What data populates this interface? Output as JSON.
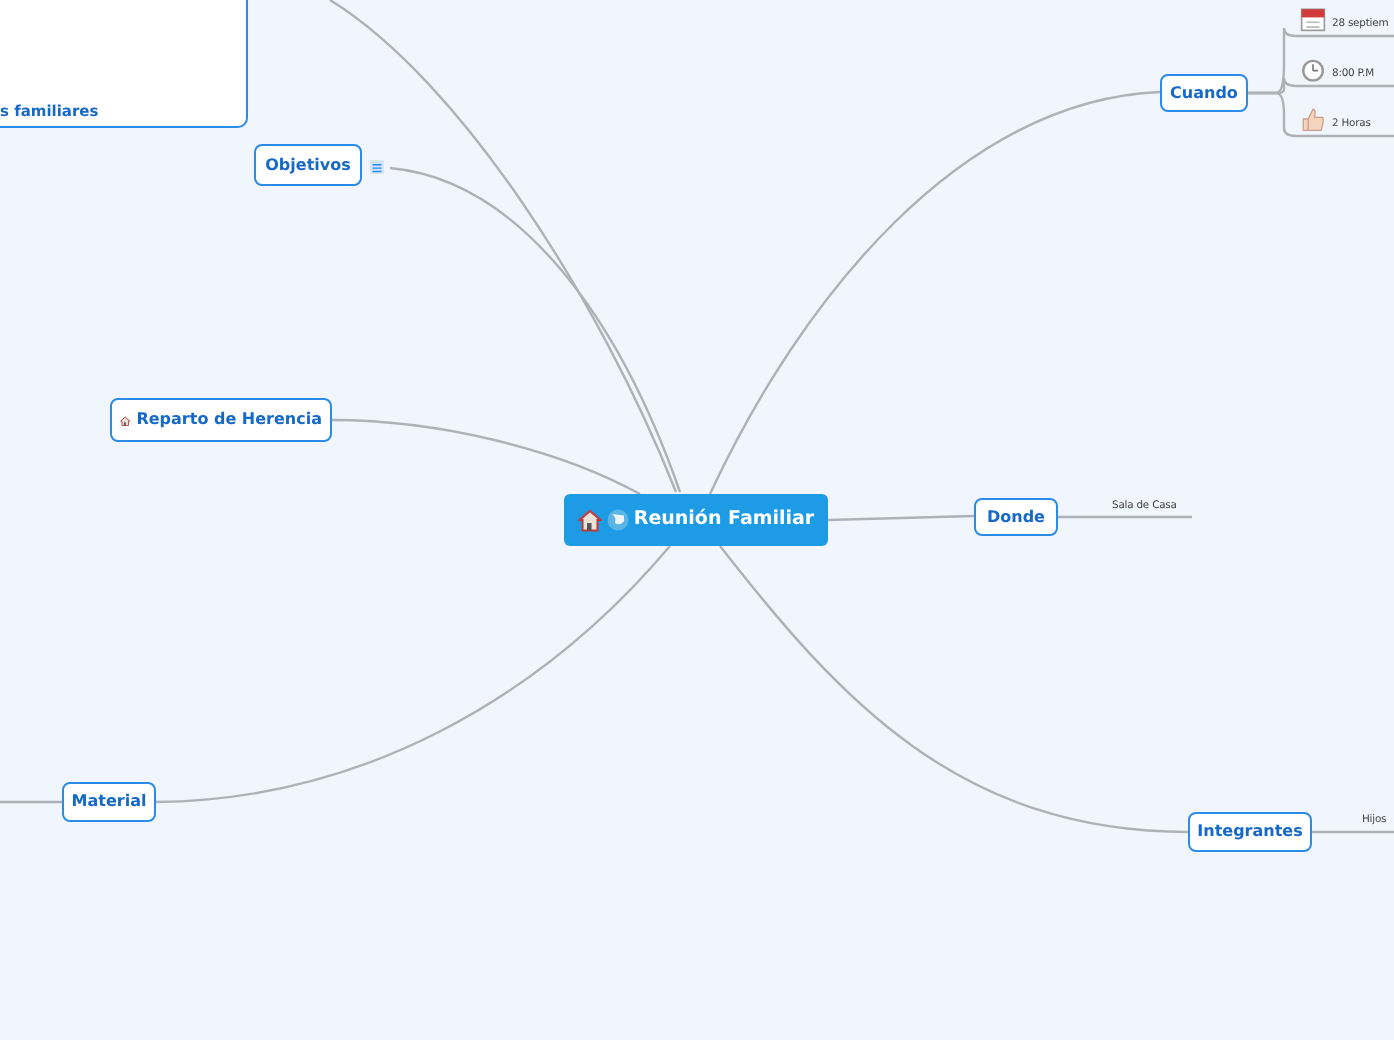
{
  "central_topic": {
    "label": "Reunión Familiar"
  },
  "topics": [
    {
      "kind": "panel",
      "label": "s familiares"
    },
    {
      "kind": "topic",
      "label": "Objetivos"
    },
    {
      "kind": "topic",
      "label": "Reparto de Herencia"
    },
    {
      "kind": "topic",
      "label": "Material"
    },
    {
      "kind": "topic",
      "label": "Cuando",
      "children": [
        {
          "label": "28 septiem"
        },
        {
          "label": "8:00 P.M"
        },
        {
          "label": "2 Horas"
        }
      ]
    },
    {
      "kind": "topic",
      "label": "Donde",
      "children": [
        {
          "label": "Sala de Casa"
        }
      ]
    },
    {
      "kind": "topic",
      "label": "Integrantes",
      "children": [
        {
          "label": "Hijos"
        }
      ]
    }
  ]
}
